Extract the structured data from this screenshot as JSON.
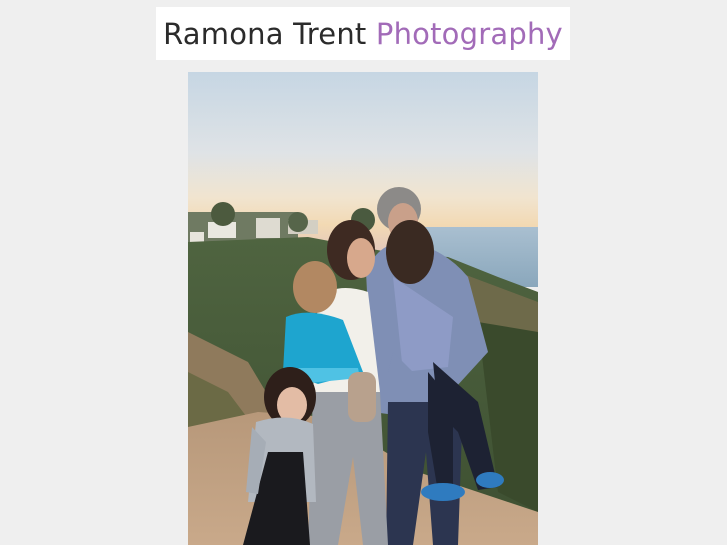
{
  "header": {
    "logo_name": "Ramona Trent",
    "logo_sub": "Photography",
    "colors": {
      "name": "#2b2b2b",
      "accent": "#a26bb8",
      "background": "#efefef"
    }
  },
  "photo": {
    "subject": "family-portrait-photo"
  }
}
